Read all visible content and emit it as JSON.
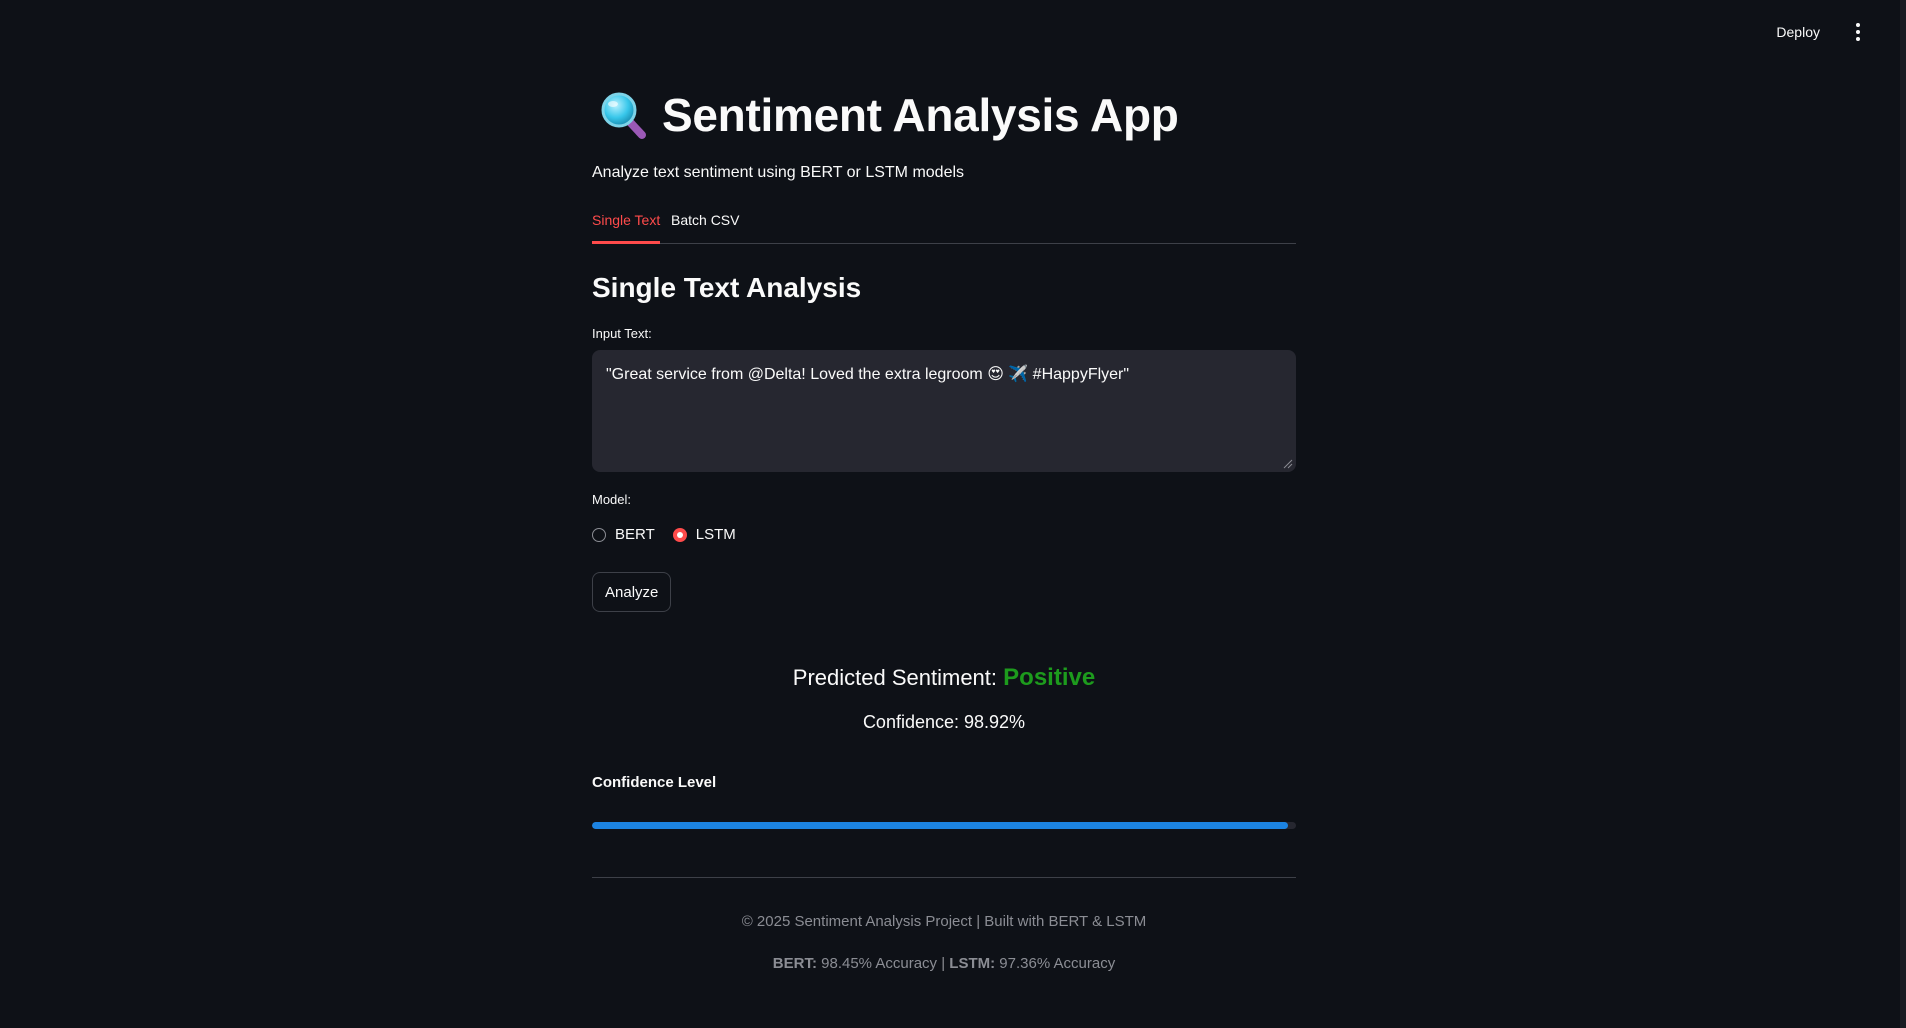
{
  "header": {
    "deploy_label": "Deploy"
  },
  "page": {
    "title": "Sentiment Analysis App",
    "subtitle": "Analyze text sentiment using BERT or LSTM models"
  },
  "tabs": [
    {
      "label": "Single Text",
      "active": true
    },
    {
      "label": "Batch CSV",
      "active": false
    }
  ],
  "single": {
    "section_title": "Single Text Analysis",
    "input_label": "Input Text:",
    "input_value": "\"Great service from @Delta! Loved the extra legroom 😍 ✈️ #HappyFlyer\"",
    "model_label": "Model:",
    "models": [
      {
        "label": "BERT",
        "selected": false
      },
      {
        "label": "LSTM",
        "selected": true
      }
    ],
    "analyze_label": "Analyze"
  },
  "result": {
    "prefix": "Predicted Sentiment:",
    "sentiment": "Positive",
    "confidence_text": "Confidence: 98.92%",
    "confidence_heading": "Confidence Level",
    "confidence_value": 0.9892
  },
  "footer": {
    "line1": "© 2025 Sentiment Analysis Project | Built with BERT & LSTM",
    "bert_label": "BERT:",
    "bert_text": "98.45% Accuracy",
    "separator": "|",
    "lstm_label": "LSTM:",
    "lstm_text": "97.36% Accuracy"
  },
  "colors": {
    "background": "#0e1117",
    "accent": "#ff4b4b",
    "positive": "#1d9b1d",
    "progress": "#1c83e1"
  }
}
